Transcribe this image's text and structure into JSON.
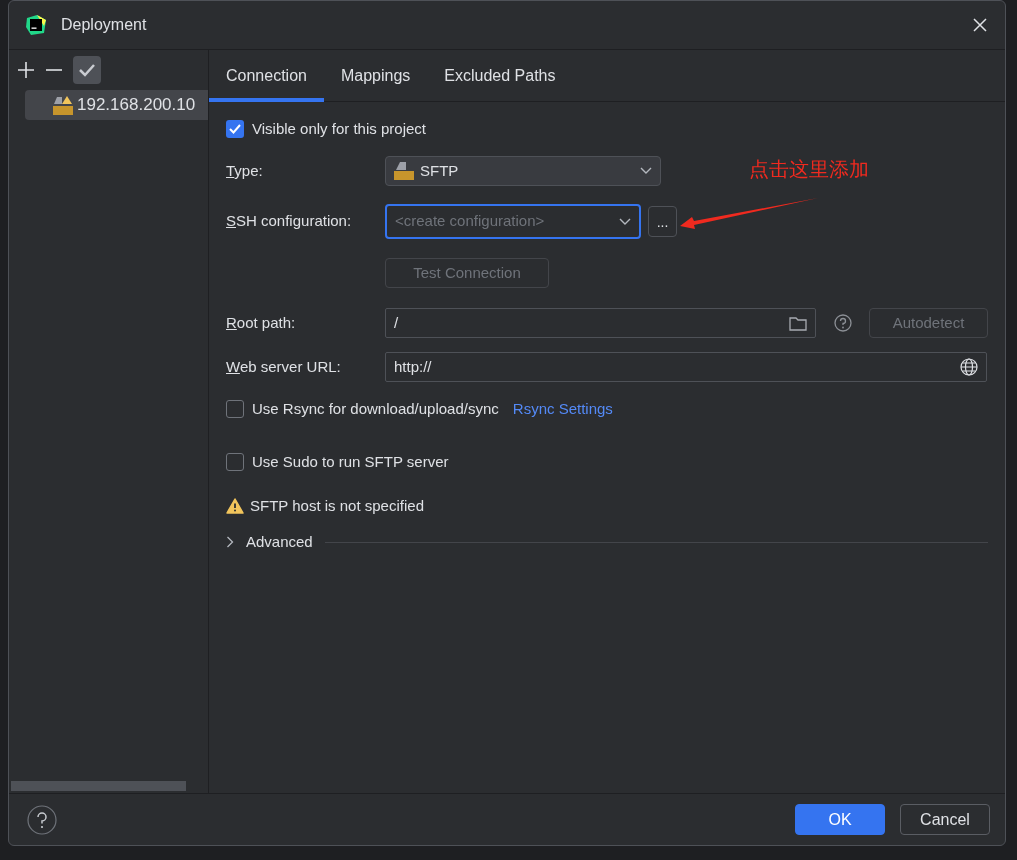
{
  "window": {
    "title": "Deployment"
  },
  "sidebar": {
    "servers": [
      {
        "label": "192.168.200.10",
        "selected": true
      }
    ]
  },
  "tabs": [
    {
      "label": "Connection",
      "selected": true
    },
    {
      "label": "Mappings",
      "selected": false
    },
    {
      "label": "Excluded Paths",
      "selected": false
    }
  ],
  "visible_only": {
    "label": "Visible only for this project",
    "checked": true
  },
  "type": {
    "label": "Type:",
    "value": "SFTP"
  },
  "ssh_configuration": {
    "label": "SSH configuration:",
    "placeholder": "<create configuration>",
    "button": "..."
  },
  "test_connection": {
    "label": "Test Connection",
    "disabled": true
  },
  "root_path": {
    "label": "Root path:",
    "value": "/",
    "autodetect": {
      "label": "Autodetect",
      "disabled": true
    }
  },
  "web_server_url": {
    "label": "Web server URL:",
    "value": "http://"
  },
  "options": [
    {
      "label": "Use Rsync for download/upload/sync",
      "checked": false,
      "link": "Rsync Settings"
    },
    {
      "label": "Use Sudo to run SFTP server",
      "checked": false
    }
  ],
  "warning": "SFTP host is not specified",
  "advanced": {
    "label": "Advanced",
    "expanded": false
  },
  "annotation": {
    "text": "点击这里添加"
  },
  "buttons": [
    {
      "label": "OK",
      "kind": "primary"
    },
    {
      "label": "Cancel",
      "kind": "secondary"
    }
  ]
}
